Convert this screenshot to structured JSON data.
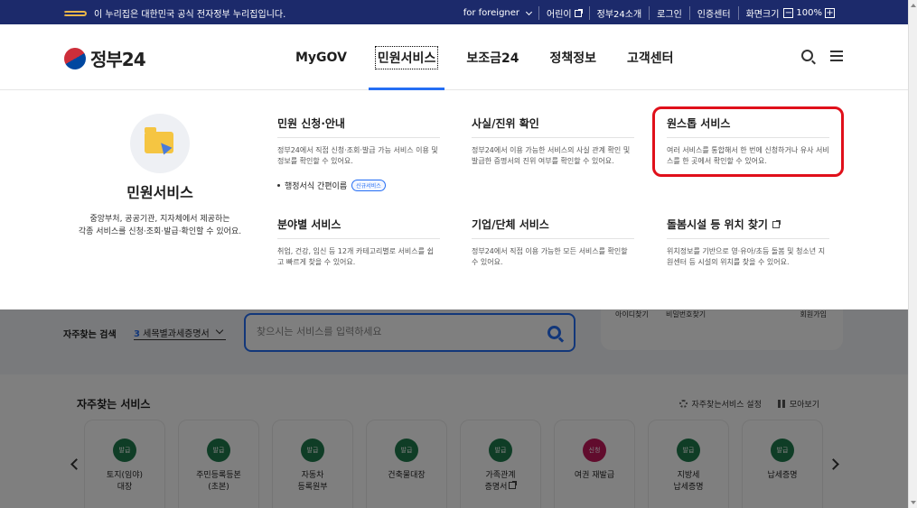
{
  "gov_bar": {
    "notice": "이 누리집은 대한민국 공식 전자정부 누리집입니다.",
    "items": [
      "for foreigner",
      "어린이",
      "정부24소개",
      "로그인",
      "인증센터"
    ],
    "zoom_label": "화면크기",
    "zoom_minus": "−",
    "zoom_value": "100%",
    "zoom_plus": "+"
  },
  "header": {
    "logo": "정부24",
    "nav": [
      "MyGOV",
      "민원서비스",
      "보조금24",
      "정책정보",
      "고객센터"
    ]
  },
  "mega": {
    "intro": {
      "title": "민원서비스",
      "desc_1": "중앙부처, 공공기관, 지자체에서 제공하는",
      "desc_2": "각종 서비스를 신청·조회·발급·확인할 수 있어요."
    },
    "columns": [
      {
        "title": "민원 신청·안내",
        "desc": "정부24에서 직접 신청·조회·발급 가능 서비스 이용 및 정보를 확인할 수 있어요.",
        "sub": "행정서식 간편이름",
        "badge": "신규서비스"
      },
      {
        "title": "사실/진위 확인",
        "desc": "정부24에서 이용 가능한 서비스의 사실 관계 확인 및 발급한 증명서의 진위 여부를 확인할 수 있어요."
      },
      {
        "title": "원스톱 서비스",
        "desc": "여러 서비스를 통합해서 한 번에 신청하거나 유사 서비스를 한 곳에서 확인할 수 있어요."
      },
      {
        "title": "분야별 서비스",
        "desc": "취업, 건강, 임신 등 12개 카테고리별로 서비스를 쉽고 빠르게 찾을 수 있어요."
      },
      {
        "title": "기업/단체 서비스",
        "desc": "정부24에서 직접 이용 가능한 모든 서비스를 확인할 수 있어요."
      },
      {
        "title": "돌봄시설 등 위치 찾기",
        "desc": "위치정보를 기반으로 영·유아/초등 돌봄 및 청소년 지원센터 등 시설의 위치를 찾을 수 있어요."
      }
    ]
  },
  "quick": {
    "label": "자주찾는 검색",
    "select_num": "3",
    "select_text": "세목별과세증명서",
    "search_placeholder": "찾으시는 서비스를 입력하세요",
    "login_links": [
      "아이디찾기",
      "비밀번호찾기",
      "회원가입"
    ]
  },
  "frequent": {
    "title": "자주찾는 서비스",
    "settings": "자주찾는서비스 설정",
    "view_all": "모아보기",
    "cards": [
      {
        "tag": "발급",
        "l1": "토지(임야)",
        "l2": "대장"
      },
      {
        "tag": "발급",
        "l1": "주민등록등본",
        "l2": "(초본)"
      },
      {
        "tag": "발급",
        "l1": "자동차",
        "l2": "등록원부"
      },
      {
        "tag": "발급",
        "l1": "건축물대장",
        "l2": ""
      },
      {
        "tag": "발급",
        "l1": "가족관계",
        "l2": "증명서"
      },
      {
        "tag": "신청",
        "l1": "여권 재발급",
        "l2": ""
      },
      {
        "tag": "발급",
        "l1": "지방세",
        "l2": "납세증명"
      },
      {
        "tag": "발급",
        "l1": "납세증명",
        "l2": ""
      }
    ]
  },
  "colors": {
    "brand_blue": "#256ef4",
    "gov_navy": "#1c2a6b",
    "highlight_red": "#e0101a",
    "issue_green": "#1f7a4d",
    "apply_pink": "#c2185b"
  }
}
